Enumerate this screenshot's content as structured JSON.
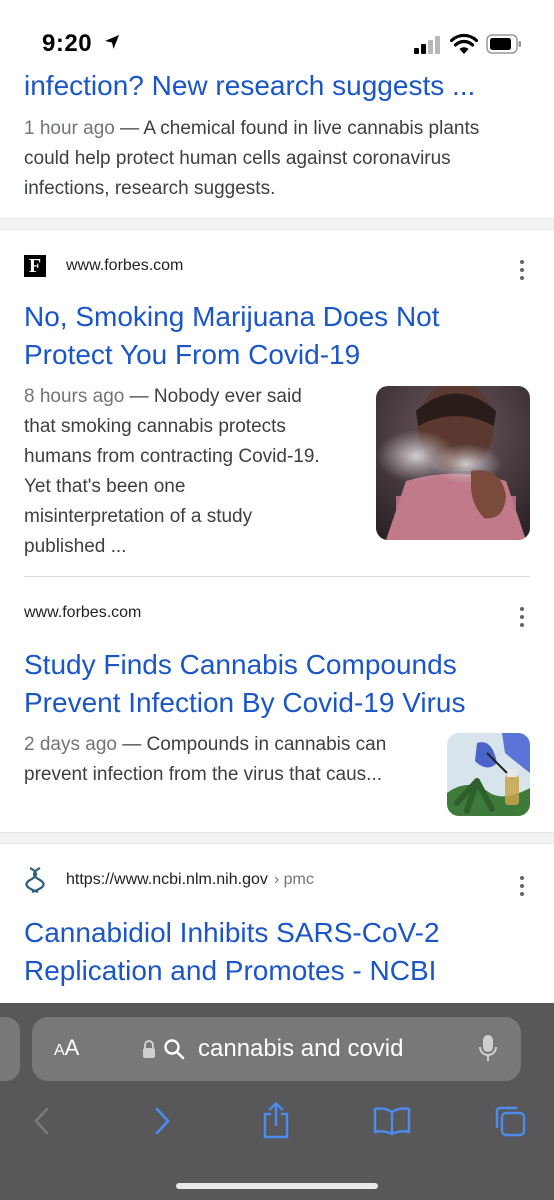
{
  "status_bar": {
    "time": "9:20"
  },
  "results": [
    {
      "title": "infection? New research suggests ...",
      "date": "1 hour ago",
      "snippet_lines": [
        "— A chemical found in live cannabis plants",
        "could help protect human cells against coronavirus",
        "infections, research suggests."
      ]
    },
    {
      "favicon_letter": "F",
      "site": "www.forbes.com",
      "title_lines": [
        "No, Smoking Marijuana Does Not",
        "Protect You From Covid-19"
      ],
      "date": "8 hours ago",
      "snippet_lines": [
        "— Nobody ever said",
        "that smoking cannabis protects",
        "humans from contracting Covid-19.",
        "Yet that's been one",
        "misinterpretation of a study",
        "published ..."
      ]
    },
    {
      "site": "www.forbes.com",
      "title_lines": [
        "Study Finds Cannabis Compounds",
        "Prevent Infection By Covid-19 Virus"
      ],
      "date": "2 days ago",
      "snippet_lines": [
        "— Compounds in cannabis can",
        "prevent infection from the virus that caus..."
      ]
    },
    {
      "site": "https://www.ncbi.nlm.nih.gov",
      "crumb": "› pmc",
      "title_lines": [
        "Cannabidiol Inhibits SARS-CoV-2",
        "Replication and Promotes - NCBI"
      ]
    }
  ],
  "browser": {
    "aa_small": "A",
    "aa_large": "A",
    "query": "cannabis and covid"
  },
  "colors": {
    "link": "#1a56c8",
    "toolbar_bg": "#58585a",
    "toolbar_icon": "#4a8cf0"
  }
}
